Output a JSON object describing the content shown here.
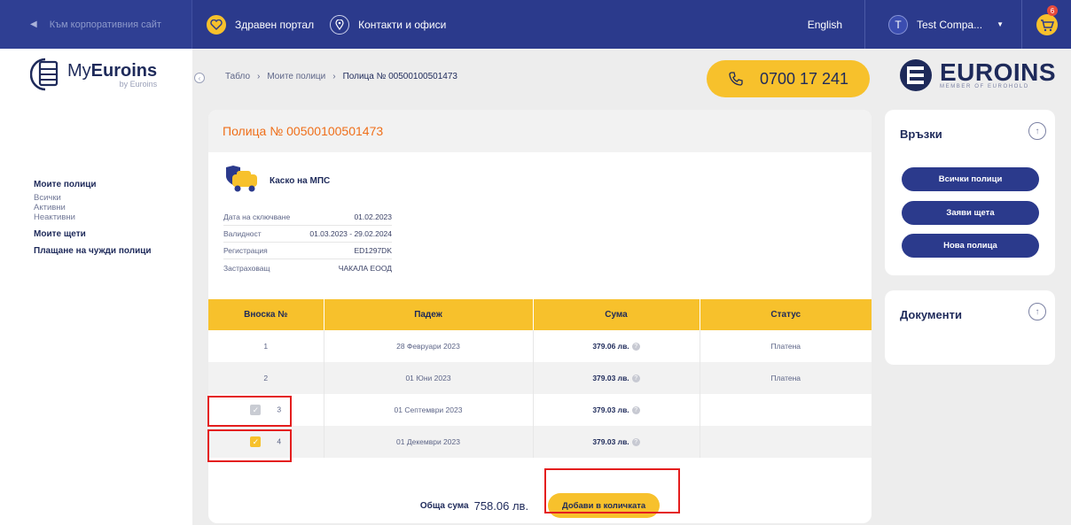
{
  "topbar": {
    "back_label": "Към корпоративния сайт",
    "health_portal": "Здравен портал",
    "contacts": "Контакти и офиси",
    "language": "English",
    "user_initial": "T",
    "user_name": "Test Compa...",
    "cart_count": "6"
  },
  "sidebar": {
    "logo_name_light": "My",
    "logo_name_bold": "Euroins",
    "logo_sub": "by Euroins",
    "sections": [
      {
        "label": "Моите полици",
        "items": [
          "Всички",
          "Активни",
          "Неактивни"
        ]
      },
      {
        "label": "Моите щети"
      },
      {
        "label": "Плащане на чужди полици"
      }
    ]
  },
  "breadcrumb": [
    "Табло",
    "Моите полици",
    "Полица № 00500100501473"
  ],
  "phone": "0700 17 241",
  "brand": {
    "name": "EUROINS",
    "sub": "MEMBER OF EUROHOLD"
  },
  "policy": {
    "title": "Полица № 00500100501473",
    "product": "Каско на МПС",
    "details": [
      {
        "label": "Дата на сключване",
        "value": "01.02.2023"
      },
      {
        "label": "Валидност",
        "value": "01.03.2023 - 29.02.2024"
      },
      {
        "label": "Регистрация",
        "value": "ED1297DK"
      },
      {
        "label": "Застраховащ",
        "value": "ЧАКАЛА ЕООД"
      }
    ]
  },
  "table": {
    "headers": [
      "Вноска №",
      "Падеж",
      "Сума",
      "Статус"
    ],
    "rows": [
      {
        "num": "1",
        "due": "28 Февруари 2023",
        "amount": "379.06 лв.",
        "status": "Платена"
      },
      {
        "num": "2",
        "due": "01 Юни 2023",
        "amount": "379.03 лв.",
        "status": "Платена"
      },
      {
        "num": "3",
        "due": "01 Септември 2023",
        "amount": "379.03 лв.",
        "status": ""
      },
      {
        "num": "4",
        "due": "01 Декември 2023",
        "amount": "379.03 лв.",
        "status": ""
      }
    ]
  },
  "total": {
    "label": "Обща сума",
    "value": "758.06 лв.",
    "button": "Добави в количката"
  },
  "links_panel": {
    "title": "Връзки",
    "buttons": [
      "Всички полици",
      "Заяви щета",
      "Нова полица"
    ]
  },
  "docs_panel": {
    "title": "Документи"
  },
  "colors": {
    "primary": "#2b3a8c",
    "accent": "#f7c12c",
    "title_orange": "#ef6f1a",
    "paid_green": "#2a9d48",
    "highlight_red": "#e41e1e"
  }
}
